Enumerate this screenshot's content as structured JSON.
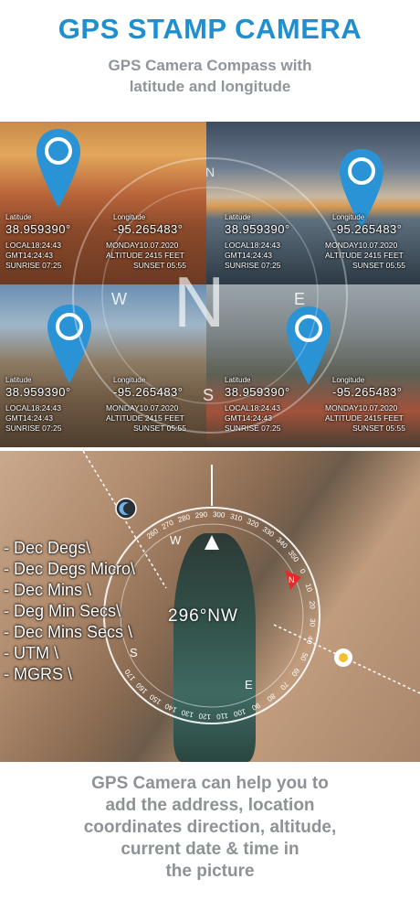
{
  "header": {
    "title": "GPS STAMP CAMERA",
    "subtitle_line1": "GPS Camera Compass with",
    "subtitle_line2": "latitude and longitude"
  },
  "tiles": [
    {
      "latitude_label": "Latitude",
      "latitude": "38.959390°",
      "longitude_label": "Longitude",
      "longitude": "-95.265483°",
      "local": "LOCAL18:24:43",
      "gmt": "GMT14:24:43",
      "sunrise": "SUNRISE  07:25",
      "date": "MONDAY10.07.2020",
      "altitude": "ALTITUDE  2415  FEET",
      "sunset": "SUNSET  05:55"
    },
    {
      "latitude_label": "Latitude",
      "latitude": "38.959390°",
      "longitude_label": "Longitude",
      "longitude": "-95.265483°",
      "local": "LOCAL18:24:43",
      "gmt": "GMT14:24:43",
      "sunrise": "SUNRISE  07:25",
      "date": "MONDAY10.07.2020",
      "altitude": "ALTITUDE  2415  FEET",
      "sunset": "SUNSET  05:55"
    },
    {
      "latitude_label": "Latitude",
      "latitude": "38.959390°",
      "longitude_label": "Longitude",
      "longitude": "-95.265483°",
      "local": "LOCAL18:24:43",
      "gmt": "GMT14:24:43",
      "sunrise": "SUNRISE  07:25",
      "date": "MONDAY10.07.2020",
      "altitude": "ALTITUDE  2415  FEET",
      "sunset": "SUNSET  05:55"
    },
    {
      "latitude_label": "Latitude",
      "latitude": "38.959390°",
      "longitude_label": "Longitude",
      "longitude": "-95.265483°",
      "local": "LOCAL18:24:43",
      "gmt": "GMT14:24:43",
      "sunrise": "SUNRISE  07:25",
      "date": "MONDAY10.07.2020",
      "altitude": "ALTITUDE  2415  FEET",
      "sunset": "SUNSET  05:55"
    }
  ],
  "compass_overlay": {
    "north": "N",
    "west": "W",
    "east": "E",
    "south": "S"
  },
  "compass": {
    "heading": "296°NW",
    "ticks": [
      "260",
      "270",
      "280",
      "290",
      "300",
      "310",
      "320",
      "330",
      "340",
      "350",
      "0",
      "10",
      "20",
      "30",
      "40",
      "50",
      "60",
      "70",
      "80",
      "90",
      "100",
      "110",
      "120",
      "130",
      "140",
      "150",
      "160",
      "170"
    ],
    "cardinal_w": "W",
    "cardinal_s": "S",
    "cardinal_n": "N",
    "cardinal_e": "E"
  },
  "formats": [
    "- Dec Degs\\",
    "- Dec Degs Micro\\",
    "- Dec Mins \\",
    "- Deg Min Secs\\",
    "- Dec Mins Secs \\",
    "- UTM \\",
    "- MGRS \\"
  ],
  "footer": {
    "line1": "GPS Camera can help you to",
    "line2": "add the address, location",
    "line3": "coordinates direction, altitude,",
    "line4": "current date & time in",
    "line5": "the picture"
  },
  "colors": {
    "brand_blue": "#1f8fd0",
    "subtitle_gray": "#8f959a",
    "pin_blue": "#2a93d5",
    "compass_red": "#e52a2a"
  }
}
